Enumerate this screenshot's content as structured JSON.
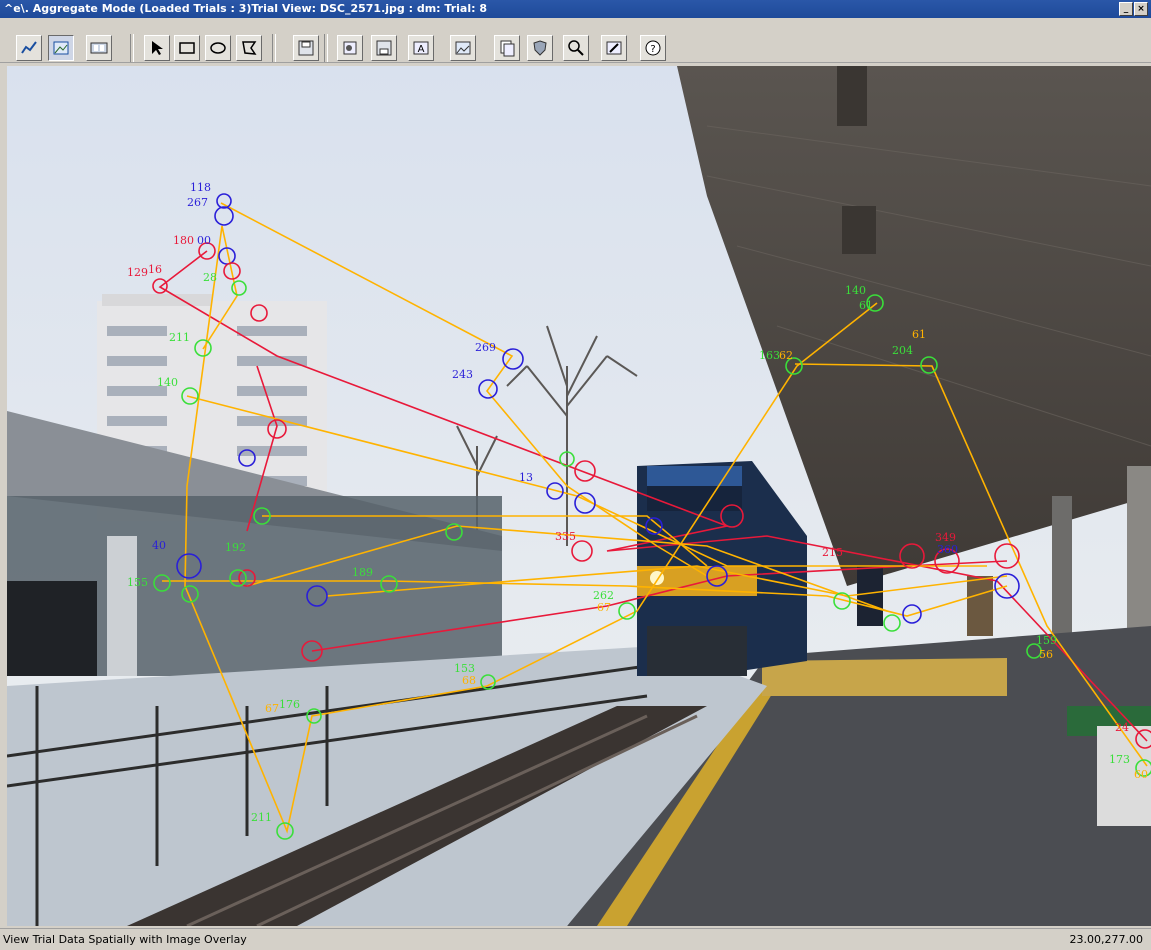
{
  "window": {
    "title": "^e\\. Aggregate Mode (Loaded Trials : 3)Trial View: DSC_2571.jpg : dm: Trial: 8",
    "buttons": [
      "_",
      "×"
    ]
  },
  "toolbar": {
    "tools": [
      {
        "name": "chart-icon"
      },
      {
        "name": "image-icon"
      },
      {
        "name": "film-icon"
      },
      {
        "name": "pointer-icon"
      },
      {
        "name": "rectangle-icon"
      },
      {
        "name": "ellipse-icon"
      },
      {
        "name": "polygon-icon"
      },
      {
        "name": "save-icon"
      },
      {
        "name": "export-image-icon"
      },
      {
        "name": "save-data-icon"
      },
      {
        "name": "text-icon"
      },
      {
        "name": "picture-icon"
      },
      {
        "name": "layers-icon"
      },
      {
        "name": "shield-icon"
      },
      {
        "name": "zoom-icon"
      },
      {
        "name": "edit-icon"
      },
      {
        "name": "help-icon"
      }
    ]
  },
  "status": {
    "left": "View Trial Data Spatially with Image Overlay",
    "right": "23.00,277.00"
  },
  "colors": {
    "trial_green": "#3adf3a",
    "trial_blue": "#2a1fd8",
    "trial_red": "#e8193a",
    "saccade": "#ffb300",
    "sky": "#e2e7ef"
  },
  "overlay": {
    "labels": [
      {
        "text": "118",
        "color": "blue"
      },
      {
        "text": "267",
        "color": "blue"
      },
      {
        "text": "180",
        "color": "red"
      },
      {
        "text": "00",
        "color": "blue"
      },
      {
        "text": "129",
        "color": "red"
      },
      {
        "text": "16",
        "color": "red"
      },
      {
        "text": "28",
        "color": "green"
      },
      {
        "text": "211",
        "color": "green"
      },
      {
        "text": "140",
        "color": "green"
      },
      {
        "text": "269",
        "color": "blue"
      },
      {
        "text": "243",
        "color": "blue"
      },
      {
        "text": "140",
        "color": "green"
      },
      {
        "text": "61",
        "color": "green"
      },
      {
        "text": "61",
        "color": "orange"
      },
      {
        "text": "204",
        "color": "green"
      },
      {
        "text": "163",
        "color": "green"
      },
      {
        "text": "62",
        "color": "orange"
      },
      {
        "text": "215",
        "color": "red"
      },
      {
        "text": "360",
        "color": "blue"
      },
      {
        "text": "349",
        "color": "red"
      },
      {
        "text": "155",
        "color": "green"
      },
      {
        "text": "40",
        "color": "blue"
      },
      {
        "text": "192",
        "color": "green"
      },
      {
        "text": "189",
        "color": "green"
      },
      {
        "text": "67",
        "color": "orange"
      },
      {
        "text": "262",
        "color": "green"
      },
      {
        "text": "153",
        "color": "green"
      },
      {
        "text": "68",
        "color": "orange"
      },
      {
        "text": "176",
        "color": "green"
      },
      {
        "text": "67",
        "color": "orange"
      },
      {
        "text": "211",
        "color": "green"
      },
      {
        "text": "13",
        "color": "blue"
      },
      {
        "text": "335",
        "color": "red"
      },
      {
        "text": "159",
        "color": "green"
      },
      {
        "text": "56",
        "color": "orange"
      },
      {
        "text": "173",
        "color": "green"
      },
      {
        "text": "60",
        "color": "orange"
      },
      {
        "text": "24",
        "color": "red"
      }
    ]
  }
}
